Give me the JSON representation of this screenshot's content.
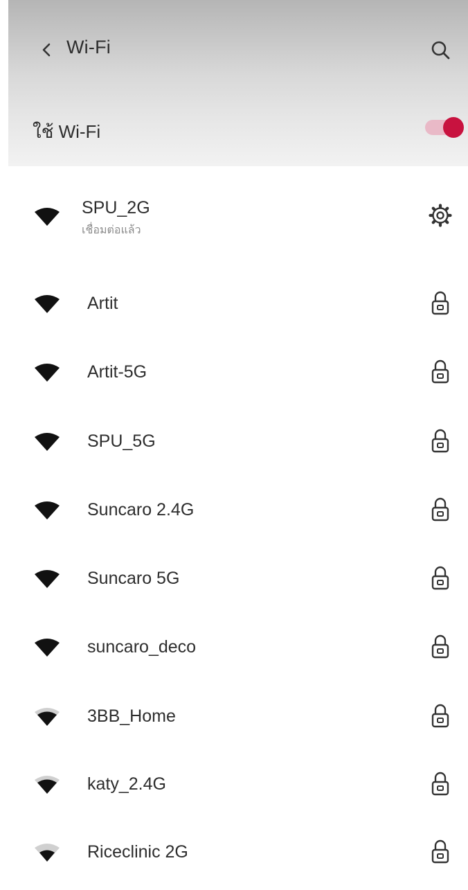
{
  "appbar": {
    "title": "Wi-Fi",
    "back_icon": "chevron-left-icon",
    "search_icon": "search-icon"
  },
  "wifi_toggle": {
    "label": "ใช้ Wi-Fi",
    "state": "on",
    "accent_color": "#c8123f"
  },
  "networks": [
    {
      "name": "SPU_2G",
      "status": "เชื่อมต่อแล้ว",
      "icon": "wifi-full-icon",
      "trailing": "settings-gear-icon",
      "signal": "full"
    },
    {
      "name": "Artit",
      "icon": "wifi-full-icon",
      "trailing": "lock-icon",
      "signal": "full"
    },
    {
      "name": "Artit-5G",
      "icon": "wifi-full-icon",
      "trailing": "lock-icon",
      "signal": "full"
    },
    {
      "name": "SPU_5G",
      "icon": "wifi-full-icon",
      "trailing": "lock-icon",
      "signal": "full"
    },
    {
      "name": "Suncaro 2.4G",
      "icon": "wifi-full-icon",
      "trailing": "lock-icon",
      "signal": "full"
    },
    {
      "name": "Suncaro 5G",
      "icon": "wifi-full-icon",
      "trailing": "lock-icon",
      "signal": "full"
    },
    {
      "name": "suncaro_deco",
      "icon": "wifi-full-icon",
      "trailing": "lock-icon",
      "signal": "full"
    },
    {
      "name": "3BB_Home",
      "icon": "wifi-medium-icon",
      "trailing": "lock-icon",
      "signal": "medium"
    },
    {
      "name": "katy_2.4G",
      "icon": "wifi-medium-icon",
      "trailing": "lock-icon",
      "signal": "medium"
    },
    {
      "name": "Riceclinic 2G",
      "icon": "wifi-weak-icon",
      "trailing": "lock-icon",
      "signal": "weak"
    }
  ]
}
